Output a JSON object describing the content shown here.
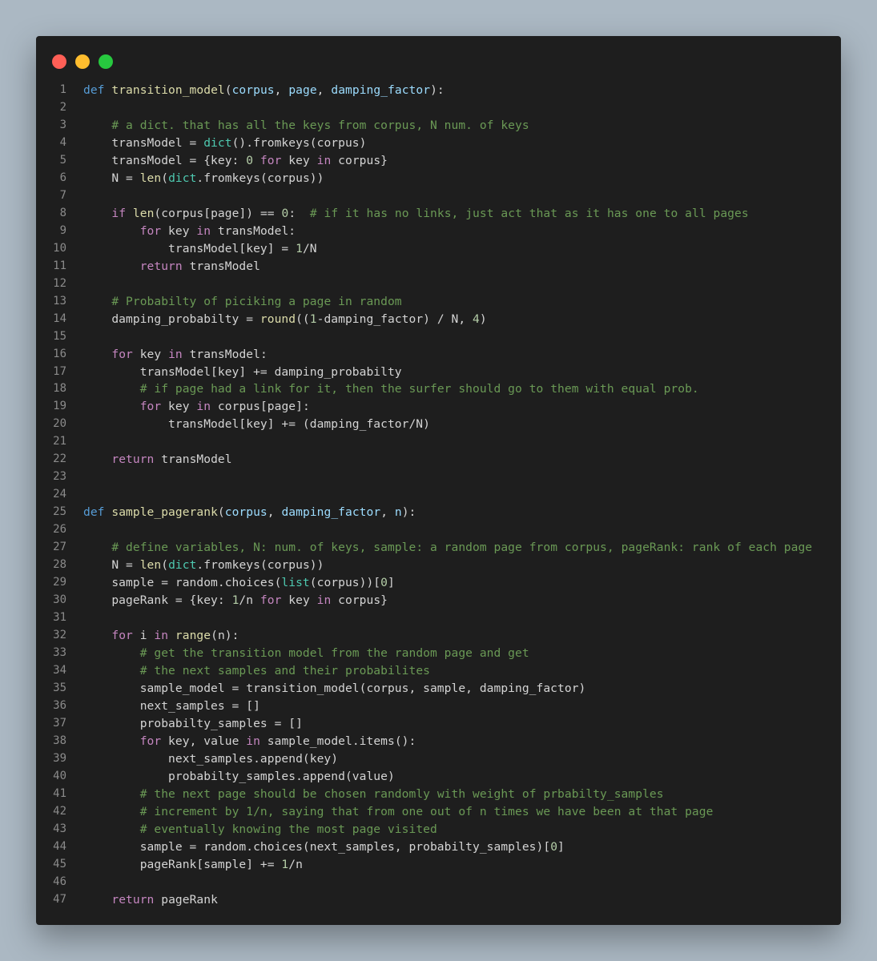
{
  "window": {
    "controls": [
      "close",
      "minimize",
      "maximize"
    ]
  },
  "colors": {
    "background": "#abb8c3",
    "editor_bg": "#1e1e1e",
    "keyword": "#569cd6",
    "function": "#dcdcaa",
    "parameter": "#9cdcfe",
    "control": "#c586c0",
    "builtin": "#4ec9b0",
    "number": "#b5cea8",
    "comment": "#6a9955",
    "text": "#d4d4d4"
  },
  "code": {
    "language": "python",
    "lines": [
      [
        [
          "kw",
          "def"
        ],
        [
          "tx",
          " "
        ],
        [
          "fn",
          "transition_model"
        ],
        [
          "tx",
          "("
        ],
        [
          "pm",
          "corpus"
        ],
        [
          "tx",
          ", "
        ],
        [
          "pm",
          "page"
        ],
        [
          "tx",
          ", "
        ],
        [
          "pm",
          "damping_factor"
        ],
        [
          "tx",
          "):"
        ]
      ],
      [],
      [
        [
          "tx",
          "    "
        ],
        [
          "cm",
          "# a dict. that has all the keys from corpus, N num. of keys"
        ]
      ],
      [
        [
          "tx",
          "    transModel = "
        ],
        [
          "bi",
          "dict"
        ],
        [
          "tx",
          "().fromkeys(corpus)"
        ]
      ],
      [
        [
          "tx",
          "    transModel = {key: "
        ],
        [
          "nm",
          "0"
        ],
        [
          "tx",
          " "
        ],
        [
          "cf",
          "for"
        ],
        [
          "tx",
          " key "
        ],
        [
          "cf",
          "in"
        ],
        [
          "tx",
          " corpus}"
        ]
      ],
      [
        [
          "tx",
          "    N = "
        ],
        [
          "fn",
          "len"
        ],
        [
          "tx",
          "("
        ],
        [
          "bi",
          "dict"
        ],
        [
          "tx",
          ".fromkeys(corpus))"
        ]
      ],
      [],
      [
        [
          "tx",
          "    "
        ],
        [
          "cf",
          "if"
        ],
        [
          "tx",
          " "
        ],
        [
          "fn",
          "len"
        ],
        [
          "tx",
          "(corpus[page]) == "
        ],
        [
          "nm",
          "0"
        ],
        [
          "tx",
          ":  "
        ],
        [
          "cm",
          "# if it has no links, just act that as it has one to all pages"
        ]
      ],
      [
        [
          "tx",
          "        "
        ],
        [
          "cf",
          "for"
        ],
        [
          "tx",
          " key "
        ],
        [
          "cf",
          "in"
        ],
        [
          "tx",
          " transModel:"
        ]
      ],
      [
        [
          "tx",
          "            transModel[key] = "
        ],
        [
          "nm",
          "1"
        ],
        [
          "tx",
          "/N"
        ]
      ],
      [
        [
          "tx",
          "        "
        ],
        [
          "cf",
          "return"
        ],
        [
          "tx",
          " transModel"
        ]
      ],
      [],
      [
        [
          "tx",
          "    "
        ],
        [
          "cm",
          "# Probabilty of piciking a page in random"
        ]
      ],
      [
        [
          "tx",
          "    damping_probabilty = "
        ],
        [
          "fn",
          "round"
        ],
        [
          "tx",
          "(("
        ],
        [
          "nm",
          "1"
        ],
        [
          "tx",
          "-damping_factor) / N, "
        ],
        [
          "nm",
          "4"
        ],
        [
          "tx",
          ")"
        ]
      ],
      [],
      [
        [
          "tx",
          "    "
        ],
        [
          "cf",
          "for"
        ],
        [
          "tx",
          " key "
        ],
        [
          "cf",
          "in"
        ],
        [
          "tx",
          " transModel:"
        ]
      ],
      [
        [
          "tx",
          "        transModel[key] += damping_probabilty"
        ]
      ],
      [
        [
          "tx",
          "        "
        ],
        [
          "cm",
          "# if page had a link for it, then the surfer should go to them with equal prob."
        ]
      ],
      [
        [
          "tx",
          "        "
        ],
        [
          "cf",
          "for"
        ],
        [
          "tx",
          " key "
        ],
        [
          "cf",
          "in"
        ],
        [
          "tx",
          " corpus[page]:"
        ]
      ],
      [
        [
          "tx",
          "            transModel[key] += (damping_factor/N)"
        ]
      ],
      [],
      [
        [
          "tx",
          "    "
        ],
        [
          "cf",
          "return"
        ],
        [
          "tx",
          " transModel"
        ]
      ],
      [],
      [],
      [
        [
          "kw",
          "def"
        ],
        [
          "tx",
          " "
        ],
        [
          "fn",
          "sample_pagerank"
        ],
        [
          "tx",
          "("
        ],
        [
          "pm",
          "corpus"
        ],
        [
          "tx",
          ", "
        ],
        [
          "pm",
          "damping_factor"
        ],
        [
          "tx",
          ", "
        ],
        [
          "pm",
          "n"
        ],
        [
          "tx",
          "):"
        ]
      ],
      [],
      [
        [
          "tx",
          "    "
        ],
        [
          "cm",
          "# define variables, N: num. of keys, sample: a random page from corpus, pageRank: rank of each page"
        ]
      ],
      [
        [
          "tx",
          "    N = "
        ],
        [
          "fn",
          "len"
        ],
        [
          "tx",
          "("
        ],
        [
          "bi",
          "dict"
        ],
        [
          "tx",
          ".fromkeys(corpus))"
        ]
      ],
      [
        [
          "tx",
          "    sample = random.choices("
        ],
        [
          "bi",
          "list"
        ],
        [
          "tx",
          "(corpus))["
        ],
        [
          "nm",
          "0"
        ],
        [
          "tx",
          "]"
        ]
      ],
      [
        [
          "tx",
          "    pageRank = {key: "
        ],
        [
          "nm",
          "1"
        ],
        [
          "tx",
          "/n "
        ],
        [
          "cf",
          "for"
        ],
        [
          "tx",
          " key "
        ],
        [
          "cf",
          "in"
        ],
        [
          "tx",
          " corpus}"
        ]
      ],
      [],
      [
        [
          "tx",
          "    "
        ],
        [
          "cf",
          "for"
        ],
        [
          "tx",
          " i "
        ],
        [
          "cf",
          "in"
        ],
        [
          "tx",
          " "
        ],
        [
          "fn",
          "range"
        ],
        [
          "tx",
          "(n):"
        ]
      ],
      [
        [
          "tx",
          "        "
        ],
        [
          "cm",
          "# get the transition model from the random page and get"
        ]
      ],
      [
        [
          "tx",
          "        "
        ],
        [
          "cm",
          "# the next samples and their probabilites"
        ]
      ],
      [
        [
          "tx",
          "        sample_model = transition_model(corpus, sample, damping_factor)"
        ]
      ],
      [
        [
          "tx",
          "        next_samples = []"
        ]
      ],
      [
        [
          "tx",
          "        probabilty_samples = []"
        ]
      ],
      [
        [
          "tx",
          "        "
        ],
        [
          "cf",
          "for"
        ],
        [
          "tx",
          " key, value "
        ],
        [
          "cf",
          "in"
        ],
        [
          "tx",
          " sample_model.items():"
        ]
      ],
      [
        [
          "tx",
          "            next_samples.append(key)"
        ]
      ],
      [
        [
          "tx",
          "            probabilty_samples.append(value)"
        ]
      ],
      [
        [
          "tx",
          "        "
        ],
        [
          "cm",
          "# the next page should be chosen randomly with weight of prbabilty_samples"
        ]
      ],
      [
        [
          "tx",
          "        "
        ],
        [
          "cm",
          "# increment by 1/n, saying that from one out of n times we have been at that page"
        ]
      ],
      [
        [
          "tx",
          "        "
        ],
        [
          "cm",
          "# eventually knowing the most page visited"
        ]
      ],
      [
        [
          "tx",
          "        sample = random.choices(next_samples, probabilty_samples)["
        ],
        [
          "nm",
          "0"
        ],
        [
          "tx",
          "]"
        ]
      ],
      [
        [
          "tx",
          "        pageRank[sample] += "
        ],
        [
          "nm",
          "1"
        ],
        [
          "tx",
          "/n"
        ]
      ],
      [],
      [
        [
          "tx",
          "    "
        ],
        [
          "cf",
          "return"
        ],
        [
          "tx",
          " pageRank"
        ]
      ]
    ]
  }
}
